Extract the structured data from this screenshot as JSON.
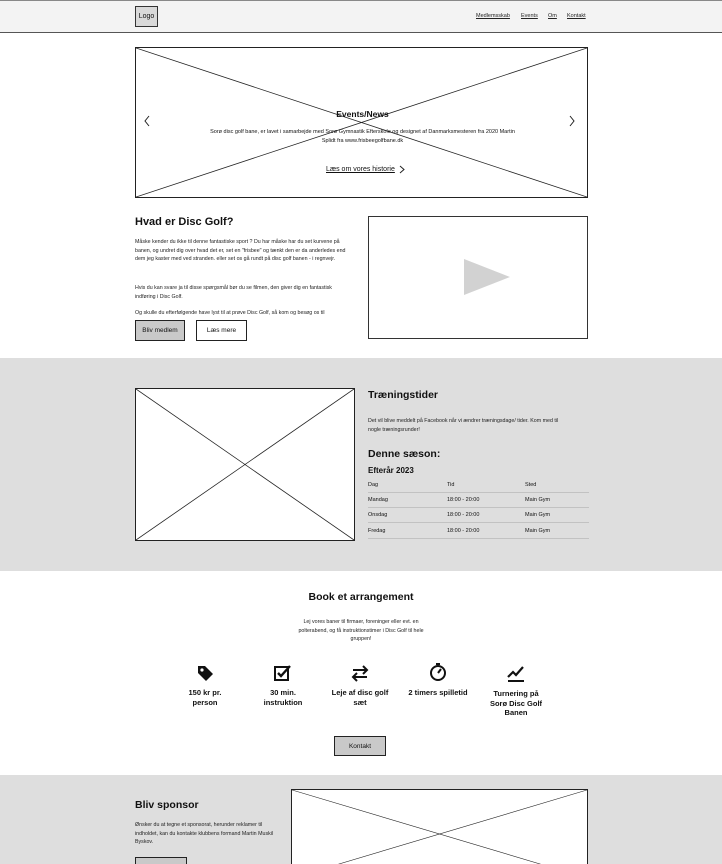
{
  "header": {
    "logo": "Logo",
    "nav": [
      "Medlemsskab",
      "Events",
      "Om",
      "Kontakt"
    ]
  },
  "hero": {
    "title": "Events/News",
    "subtitle": "Sorø disc golf bane, er lavet i samarbejde med Sorø Gymnastik Efterskole og designet af Danmarksmesteren fra 2020 Martin Splidt fra www.frisbeegolfbane.dk",
    "link": "Læs om vores historie",
    "prev_icon": "chevron-left-icon",
    "next_icon": "chevron-right-icon"
  },
  "about": {
    "title": "Hvad er Disc Golf?",
    "p1": "Måske kender du ikke til denne fantastiske sport ? Du har måske har du set kurvene på banen, og undret dig over hvad det er, set en \"frisbee\" og tænkt den er da anderledes end dem jeg kaster med ved stranden. eller set os gå rundt på disc golf banen - i regnvejr.",
    "p2": "Hvis du kan svare ja til disse spørgsmål bør du se filmen, den giver dig en fantastisk indføring i Disc Golf.",
    "p3": "Og skulle du efterfølgende have lyst til at prøve Disc Golf, så kom og besøg os til",
    "btn_member": "Bliv medlem",
    "btn_more": "Læs mere",
    "video_icon": "play-icon"
  },
  "training": {
    "title": "Træningstider",
    "text": "Det vil blive meddelt på Facebook når vi ændrer træningsdage/ tider. Kom med til nogle træningsrunder!",
    "season_title": "Denne sæson:",
    "season_name": "Efterår 2023",
    "columns": [
      "Dag",
      "Tid",
      "Sted"
    ],
    "rows": [
      [
        "Mandag",
        "18:00 - 20:00",
        "Main Gym"
      ],
      [
        "Onsdag",
        "18:00 - 20:00",
        "Main Gym"
      ],
      [
        "Fredag",
        "18:00 - 20:00",
        "Main Gym"
      ]
    ]
  },
  "book": {
    "title": "Book et arrangement",
    "text": "Lej vores baner til firmaer, foreninger eller evt. en polterabend, og få instruktionstimer i Disc Golf til hele gruppen!",
    "features": [
      {
        "icon": "price-tag-icon",
        "label": "150 kr pr. person"
      },
      {
        "icon": "checkbox-icon",
        "label": "30 min. instruktion"
      },
      {
        "icon": "swap-arrows-icon",
        "label": "Leje af disc golf sæt"
      },
      {
        "icon": "timer-icon",
        "label": "2 timers spilletid"
      },
      {
        "icon": "trend-chart-icon",
        "label": "Turnering på Sorø Disc Golf Banen"
      }
    ],
    "button": "Kontakt"
  },
  "sponsor": {
    "title": "Bliv sponsor",
    "text": "Ønsker du at tegne et sponsorat, herunder reklamer til indholdet, kan du kontakte klubbens formand Martin Muskil Byskov."
  }
}
